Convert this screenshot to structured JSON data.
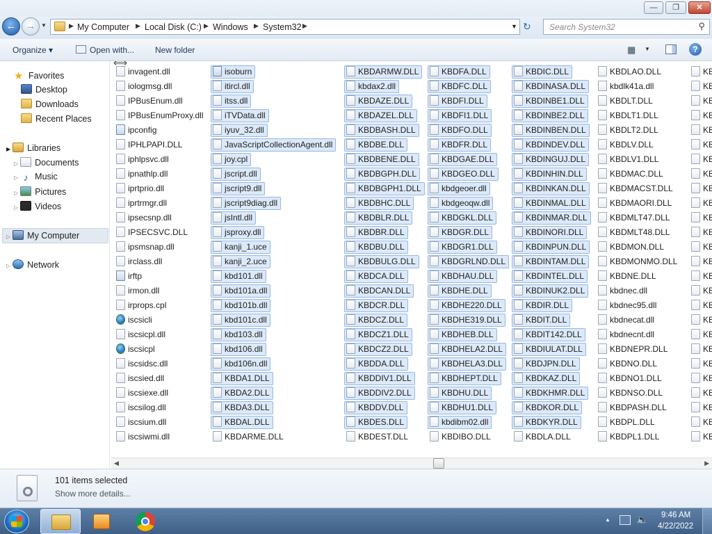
{
  "window": {
    "controls": {
      "minimize": "—",
      "maximize": "❐",
      "close": "✕"
    }
  },
  "address": {
    "crumbs": [
      "My Computer",
      "Local Disk (C:)",
      "Windows",
      "System32"
    ],
    "search_placeholder": "Search System32"
  },
  "toolbar": {
    "organize": "Organize ▾",
    "open_with": "Open with...",
    "new_folder": "New folder"
  },
  "sidebar": {
    "favorites": "Favorites",
    "desktop": "Desktop",
    "downloads": "Downloads",
    "recent_places": "Recent Places",
    "libraries": "Libraries",
    "documents": "Documents",
    "music": "Music",
    "pictures": "Pictures",
    "videos": "Videos",
    "my_computer": "My Computer",
    "network": "Network"
  },
  "files": {
    "col1": [
      "invagent.dll",
      "iologmsg.dll",
      "IPBusEnum.dll",
      "IPBusEnumProxy.dll",
      "ipconfig",
      "IPHLPAPI.DLL",
      "iphlpsvc.dll",
      "ipnathlp.dll",
      "iprtprio.dll",
      "iprtrmgr.dll",
      "ipsecsnp.dll",
      "IPSECSVC.DLL",
      "ipsmsnap.dll",
      "irclass.dll",
      "irftp",
      "irmon.dll",
      "irprops.cpl",
      "iscsicli",
      "iscsicpl.dll",
      "iscsicpl",
      "iscsidsc.dll",
      "iscsied.dll",
      "iscsiexe.dll",
      "iscsilog.dll",
      "iscsium.dll",
      "iscsiwmi.dll"
    ],
    "col2": [
      "isoburn",
      "itircl.dll",
      "itss.dll",
      "iTVData.dll",
      "iyuv_32.dll",
      "JavaScriptCollectionAgent.dll",
      "joy.cpl",
      "jscript.dll",
      "jscript9.dll",
      "jscript9diag.dll",
      "jsIntl.dll",
      "jsproxy.dll",
      "kanji_1.uce",
      "kanji_2.uce",
      "kbd101.dll",
      "kbd101a.dll",
      "kbd101b.dll",
      "kbd101c.dll",
      "kbd103.dll",
      "kbd106.dll",
      "kbd106n.dll",
      "KBDA1.DLL",
      "KBDA2.DLL",
      "KBDA3.DLL",
      "KBDAL.DLL",
      "KBDARME.DLL"
    ],
    "col3": [
      "KBDARMW.DLL",
      "kbdax2.dll",
      "KBDAZE.DLL",
      "KBDAZEL.DLL",
      "KBDBASH.DLL",
      "KBDBE.DLL",
      "KBDBENE.DLL",
      "KBDBGPH.DLL",
      "KBDBGPH1.DLL",
      "KBDBHC.DLL",
      "KBDBLR.DLL",
      "KBDBR.DLL",
      "KBDBU.DLL",
      "KBDBULG.DLL",
      "KBDCA.DLL",
      "KBDCAN.DLL",
      "KBDCR.DLL",
      "KBDCZ.DLL",
      "KBDCZ1.DLL",
      "KBDCZ2.DLL",
      "KBDDA.DLL",
      "KBDDIV1.DLL",
      "KBDDIV2.DLL",
      "KBDDV.DLL",
      "KBDES.DLL",
      "KBDEST.DLL"
    ],
    "col4": [
      "KBDFA.DLL",
      "KBDFC.DLL",
      "KBDFI.DLL",
      "KBDFI1.DLL",
      "KBDFO.DLL",
      "KBDFR.DLL",
      "KBDGAE.DLL",
      "KBDGEO.DLL",
      "kbdgeoer.dll",
      "kbdgeoqw.dll",
      "KBDGKL.DLL",
      "KBDGR.DLL",
      "KBDGR1.DLL",
      "KBDGRLND.DLL",
      "KBDHAU.DLL",
      "KBDHE.DLL",
      "KBDHE220.DLL",
      "KBDHE319.DLL",
      "KBDHEB.DLL",
      "KBDHELA2.DLL",
      "KBDHELA3.DLL",
      "KBDHEPT.DLL",
      "KBDHU.DLL",
      "KBDHU1.DLL",
      "kbdibm02.dll",
      "KBDIBO.DLL"
    ],
    "col5": [
      "KBDIC.DLL",
      "KBDINASA.DLL",
      "KBDINBE1.DLL",
      "KBDINBE2.DLL",
      "KBDINBEN.DLL",
      "KBDINDEV.DLL",
      "KBDINGUJ.DLL",
      "KBDINHIN.DLL",
      "KBDINKAN.DLL",
      "KBDINMAL.DLL",
      "KBDINMAR.DLL",
      "KBDINORI.DLL",
      "KBDINPUN.DLL",
      "KBDINTAM.DLL",
      "KBDINTEL.DLL",
      "KBDINUK2.DLL",
      "KBDIR.DLL",
      "KBDIT.DLL",
      "KBDIT142.DLL",
      "KBDIULAT.DLL",
      "KBDJPN.DLL",
      "KBDKAZ.DLL",
      "KBDKHMR.DLL",
      "KBDKOR.DLL",
      "KBDKYR.DLL",
      "KBDLA.DLL"
    ],
    "col6": [
      "KBDLAO.DLL",
      "kbdlk41a.dll",
      "KBDLT.DLL",
      "KBDLT1.DLL",
      "KBDLT2.DLL",
      "KBDLV.DLL",
      "KBDLV1.DLL",
      "KBDMAC.DLL",
      "KBDMACST.DLL",
      "KBDMAORI.DLL",
      "KBDMLT47.DLL",
      "KBDMLT48.DLL",
      "KBDMON.DLL",
      "KBDMONMO.DLL",
      "KBDNE.DLL",
      "kbdnec.dll",
      "kbdnec95.dll",
      "kbdnecat.dll",
      "kbdnecnt.dll",
      "KBDNEPR.DLL",
      "KBDNO.DLL",
      "KBDNO1.DLL",
      "KBDNSO.DLL",
      "KBDPASH.DLL",
      "KBDPL.DLL",
      "KBDPL1.DLL"
    ],
    "col7": [
      "KB",
      "KB",
      "KB",
      "KB",
      "KB",
      "KB",
      "KB",
      "KB",
      "KB",
      "KB",
      "KB",
      "KB",
      "KB",
      "KB",
      "KB",
      "KB",
      "KB",
      "KB",
      "KB",
      "KB",
      "KB",
      "KB",
      "KB",
      "KB",
      "KB",
      "KB"
    ]
  },
  "details": {
    "selected": "101 items selected",
    "more": "Show more details..."
  },
  "taskbar": {
    "time": "9:46 AM",
    "date": "4/22/2022"
  }
}
